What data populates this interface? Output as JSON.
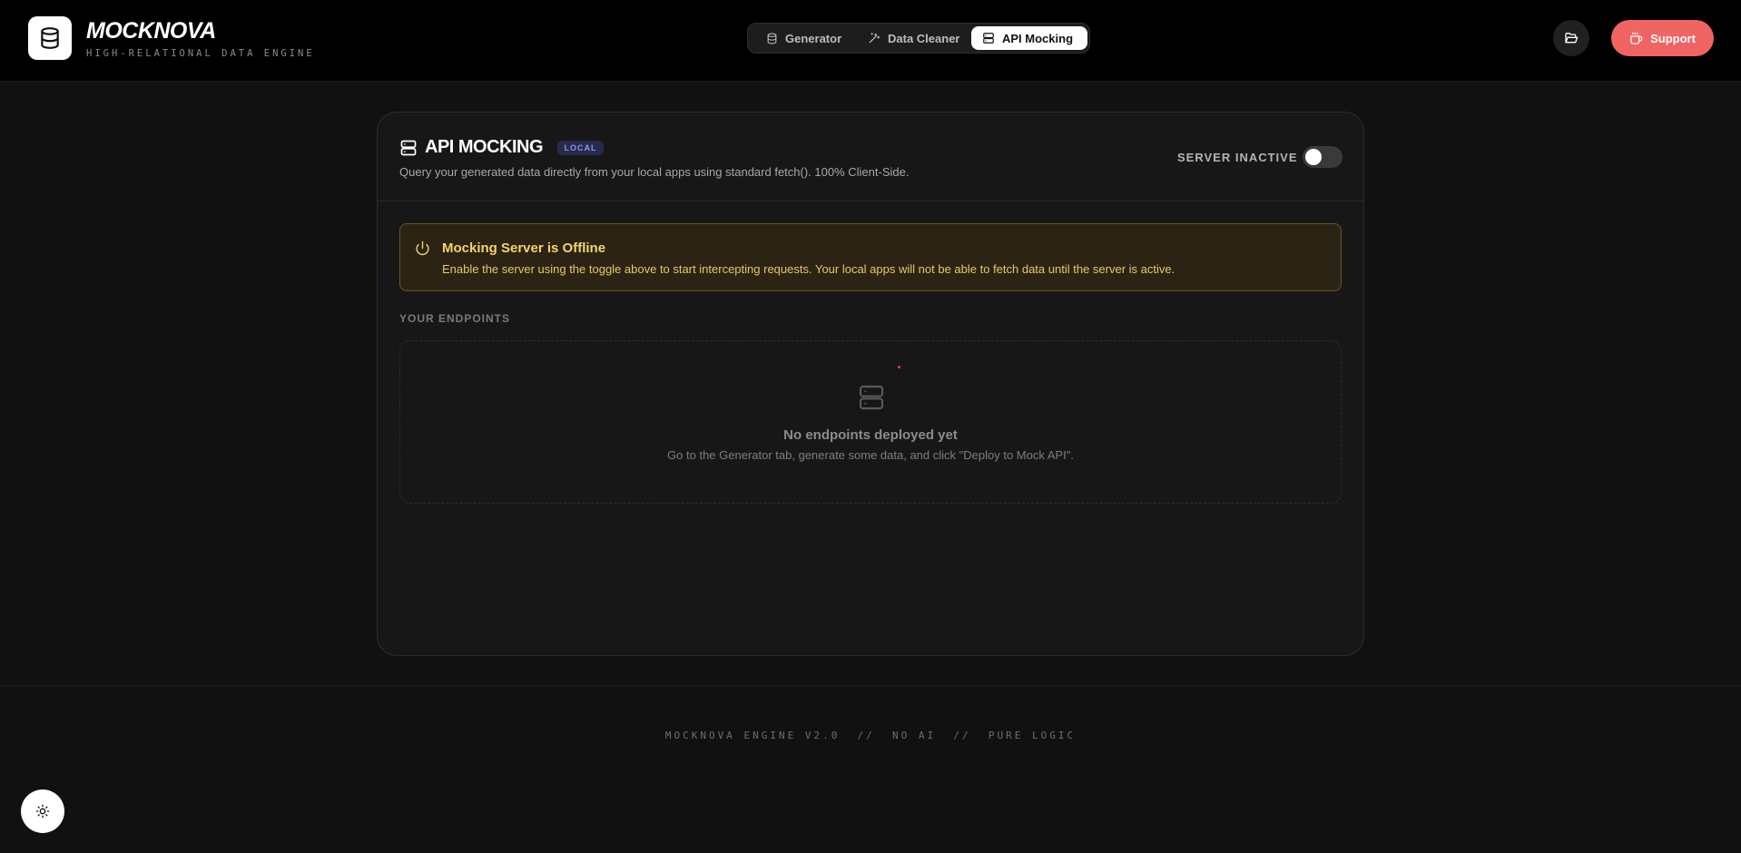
{
  "header": {
    "brand_name": "MOCKNOVA",
    "brand_sub": "HIGH-RELATIONAL DATA ENGINE",
    "logo_icon": "database-icon",
    "nav": [
      {
        "label": "Generator",
        "icon": "database-icon",
        "active": false
      },
      {
        "label": "Data Cleaner",
        "icon": "wand-icon",
        "active": false
      },
      {
        "label": "API Mocking",
        "icon": "server-icon",
        "active": true
      }
    ],
    "folder_icon": "folder-open-icon",
    "support_label": "Support",
    "support_icon": "coffee-icon"
  },
  "card": {
    "title": "API MOCKING",
    "badge": "LOCAL",
    "description": "Query your generated data directly from your local apps using standard fetch(). 100% Client-Side.",
    "server_status": "SERVER INACTIVE",
    "toggle_on": false
  },
  "alert": {
    "icon": "power-icon",
    "title": "Mocking Server is Offline",
    "text": "Enable the server using the toggle above to start intercepting requests. Your local apps will not be able to fetch data until the server is active."
  },
  "endpoints": {
    "section_label": "YOUR ENDPOINTS",
    "empty_title": "No endpoints deployed yet",
    "empty_text": "Go to the Generator tab, generate some data, and click \"Deploy to Mock API\"."
  },
  "footer": {
    "text": "MOCKNOVA ENGINE V2.0  //  NO AI  //  PURE LOGIC"
  },
  "theme_toggle_icon": "sun-icon",
  "colors": {
    "accent_support": "#f06464",
    "alert_text": "#f5d46a",
    "badge_text": "#8d95f5"
  }
}
